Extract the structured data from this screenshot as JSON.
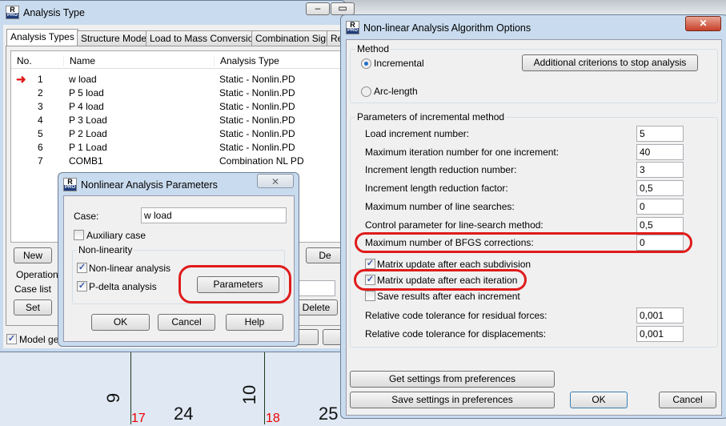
{
  "background": {
    "labels": [
      "9",
      "10",
      "24",
      "25"
    ],
    "red_labels": [
      "17",
      "18"
    ]
  },
  "analysis_window": {
    "title": "Analysis Type",
    "tabs": [
      "Analysis Types",
      "Structure Model",
      "Load to Mass Conversion",
      "Combination Sign",
      "Re"
    ],
    "columns": [
      "No.",
      "Name",
      "Analysis Type"
    ],
    "rows": [
      {
        "no": "1",
        "name": "w load",
        "type": "Static - Nonlin.PD",
        "current": true
      },
      {
        "no": "2",
        "name": "P 5 load",
        "type": "Static - Nonlin.PD"
      },
      {
        "no": "3",
        "name": "P 4 load",
        "type": "Static - Nonlin.PD"
      },
      {
        "no": "4",
        "name": "P 3 Load",
        "type": "Static - Nonlin.PD"
      },
      {
        "no": "5",
        "name": "P 2 Load",
        "type": "Static - Nonlin.PD"
      },
      {
        "no": "6",
        "name": "P 1 Load",
        "type": "Static - Nonlin.PD"
      },
      {
        "no": "7",
        "name": "COMB1",
        "type": "Combination NL PD"
      }
    ],
    "new_label": "New",
    "delete_top_label": "De",
    "operation_label": "Operation",
    "case_list_label": "Case list",
    "set_label": "Set",
    "delete_label": "Delete",
    "model_label": "Model ge",
    "model_checked": true,
    "bottom_btn_label": "e"
  },
  "nl_params": {
    "title": "Nonlinear Analysis Parameters",
    "case_label": "Case:",
    "case_value": "w load",
    "auxiliary_label": "Auxiliary case",
    "auxiliary_checked": false,
    "group_label": "Non-linearity",
    "nonlinear_label": "Non-linear analysis",
    "nonlinear_checked": true,
    "pdelta_label": "P-delta analysis",
    "pdelta_checked": true,
    "parameters_label": "Parameters",
    "ok": "OK",
    "cancel": "Cancel",
    "help": "Help"
  },
  "algo": {
    "title": "Non-linear Analysis Algorithm Options",
    "method_label": "Method",
    "incremental_label": "Incremental",
    "incremental_selected": true,
    "arc_label": "Arc-length",
    "additional_label": "Additional criterions to stop analysis",
    "params_label": "Parameters of incremental method",
    "fields": [
      {
        "label": "Load increment number:",
        "value": "5"
      },
      {
        "label": "Maximum iteration number for one increment:",
        "value": "40"
      },
      {
        "label": "Increment length reduction number:",
        "value": "3"
      },
      {
        "label": "Increment length reduction factor:",
        "value": "0,5"
      },
      {
        "label": "Maximum number of line searches:",
        "value": "0"
      },
      {
        "label": "Control parameter for line-search method:",
        "value": "0,5"
      },
      {
        "label": "Maximum number of BFGS corrections:",
        "value": "0"
      }
    ],
    "checks": [
      {
        "label": "Matrix update after each subdivision",
        "checked": true
      },
      {
        "label": "Matrix update after each iteration",
        "checked": true
      },
      {
        "label": "Save results after each increment",
        "checked": false
      }
    ],
    "tolerances": [
      {
        "label": "Relative code tolerance for residual forces:",
        "value": "0,001"
      },
      {
        "label": "Relative code tolerance for displacements:",
        "value": "0,001"
      }
    ],
    "get_settings": "Get settings from preferences",
    "save_settings": "Save settings in preferences",
    "ok": "OK",
    "cancel": "Cancel"
  },
  "colors": {
    "highlight": "#e01b1b",
    "arrow": "#e01b1b"
  }
}
